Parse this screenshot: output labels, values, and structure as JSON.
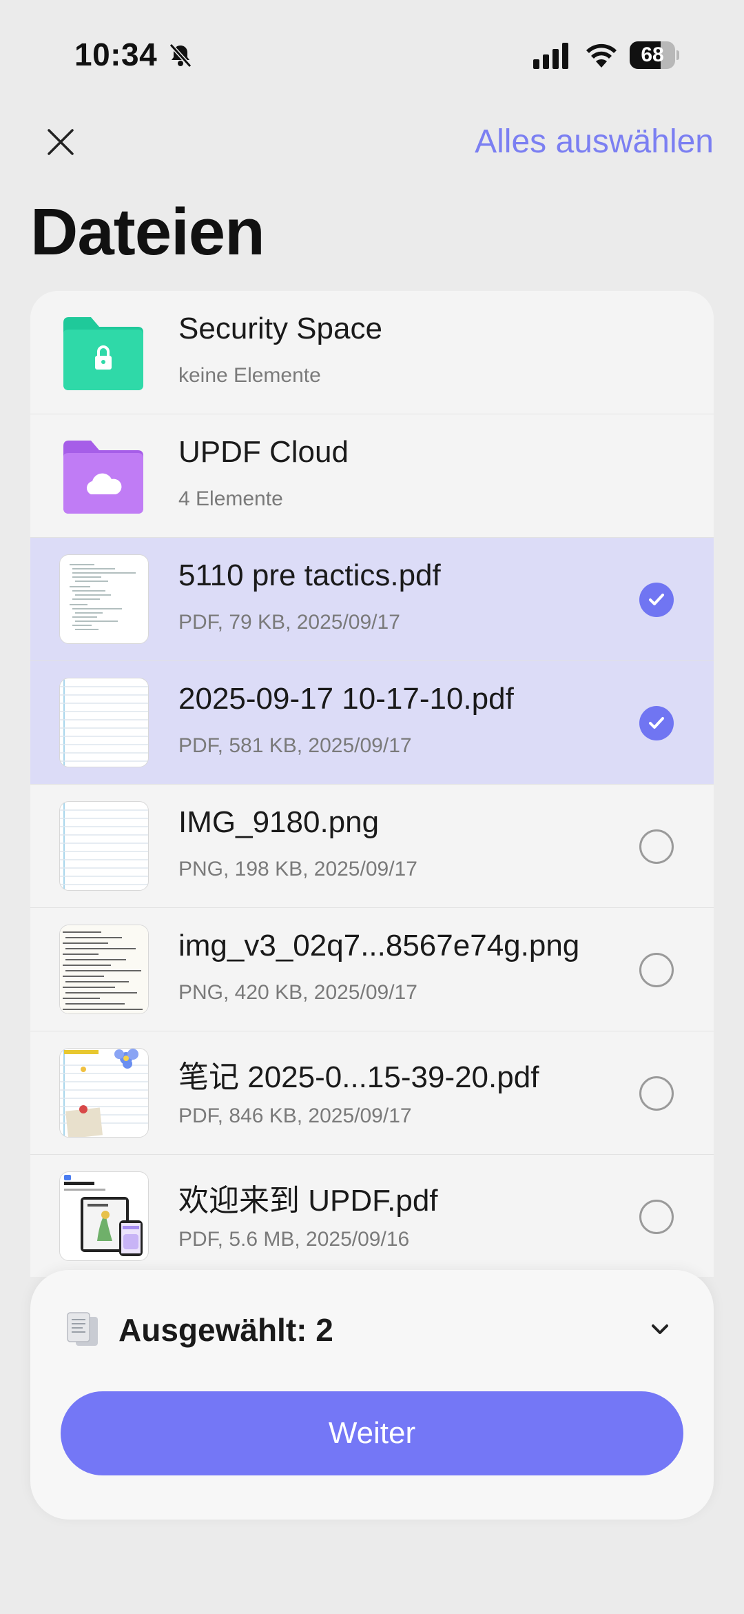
{
  "status_bar": {
    "time": "10:34",
    "battery": "68",
    "battery_level": 0.68
  },
  "header": {
    "select_all_label": "Alles auswählen",
    "title": "Dateien"
  },
  "items": [
    {
      "name": "Security Space",
      "meta": "keine Elemente",
      "kind": "folder",
      "icon": "lock-folder-icon",
      "color": "#1fc99a"
    },
    {
      "name": "UPDF Cloud",
      "meta": "4 Elemente",
      "kind": "folder",
      "icon": "cloud-folder-icon",
      "color": "#b56cf0"
    },
    {
      "name": "5110 pre tactics.pdf",
      "meta": "PDF, 79 KB, 2025/09/17",
      "kind": "file",
      "selected": true
    },
    {
      "name": "2025-09-17 10-17-10.pdf",
      "meta": "PDF, 581 KB, 2025/09/17",
      "kind": "file",
      "selected": true
    },
    {
      "name": "IMG_9180.png",
      "meta": "PNG, 198 KB, 2025/09/17",
      "kind": "file",
      "selected": false
    },
    {
      "name": "img_v3_02q7...8567e74g.png",
      "meta": "PNG, 420 KB, 2025/09/17",
      "kind": "file",
      "selected": false
    },
    {
      "name": " 笔记 2025-0...15-39-20.pdf",
      "meta": "PDF, 846 KB, 2025/09/17",
      "kind": "file",
      "selected": false
    },
    {
      "name": "欢迎来到 UPDF.pdf",
      "meta": "PDF, 5.6 MB, 2025/09/16",
      "kind": "file",
      "selected": false
    }
  ],
  "bottom_sheet": {
    "selected_label": "Ausgewählt: 2",
    "continue_label": "Weiter"
  },
  "colors": {
    "accent": "#7075f2",
    "selected_row": "#dcdcf7"
  }
}
